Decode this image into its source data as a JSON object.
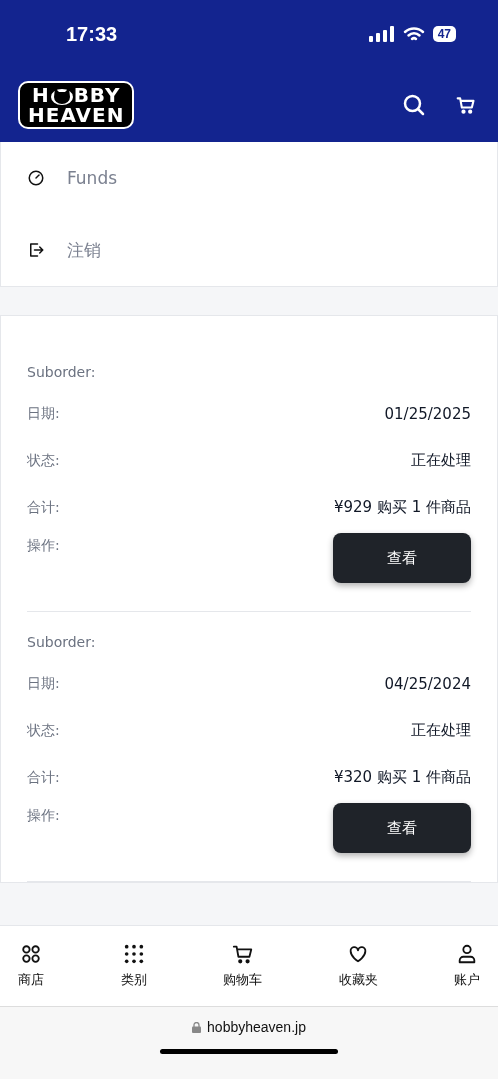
{
  "status_bar": {
    "time": "17:33",
    "battery": "47"
  },
  "header": {
    "logo": {
      "line1_start": "H",
      "line1_end": "BBY",
      "line2": "HEAVEN"
    }
  },
  "menu": [
    {
      "kind": "funds",
      "label": "Funds"
    },
    {
      "kind": "logout",
      "label": "注销"
    }
  ],
  "orders": [
    {
      "title": "Suborder:",
      "rows": [
        {
          "label": "日期:",
          "value": "01/25/2025"
        },
        {
          "label": "状态:",
          "value": "正在处理"
        },
        {
          "label": "合计:",
          "value": "¥929 购买 1 件商品"
        }
      ],
      "action_label": "操作:",
      "button": "查看"
    },
    {
      "title": "Suborder:",
      "rows": [
        {
          "label": "日期:",
          "value": "04/25/2024"
        },
        {
          "label": "状态:",
          "value": "正在处理"
        },
        {
          "label": "合计:",
          "value": "¥320 购买 1 件商品"
        }
      ],
      "action_label": "操作:",
      "button": "查看"
    }
  ],
  "bottom_nav": [
    {
      "kind": "shop",
      "label": "商店"
    },
    {
      "kind": "categories",
      "label": "类别"
    },
    {
      "kind": "cart",
      "label": "购物车"
    },
    {
      "kind": "favorites",
      "label": "收藏夹"
    },
    {
      "kind": "account",
      "label": "账户"
    }
  ],
  "url_bar": {
    "url": "hobbyheaven.jp"
  }
}
